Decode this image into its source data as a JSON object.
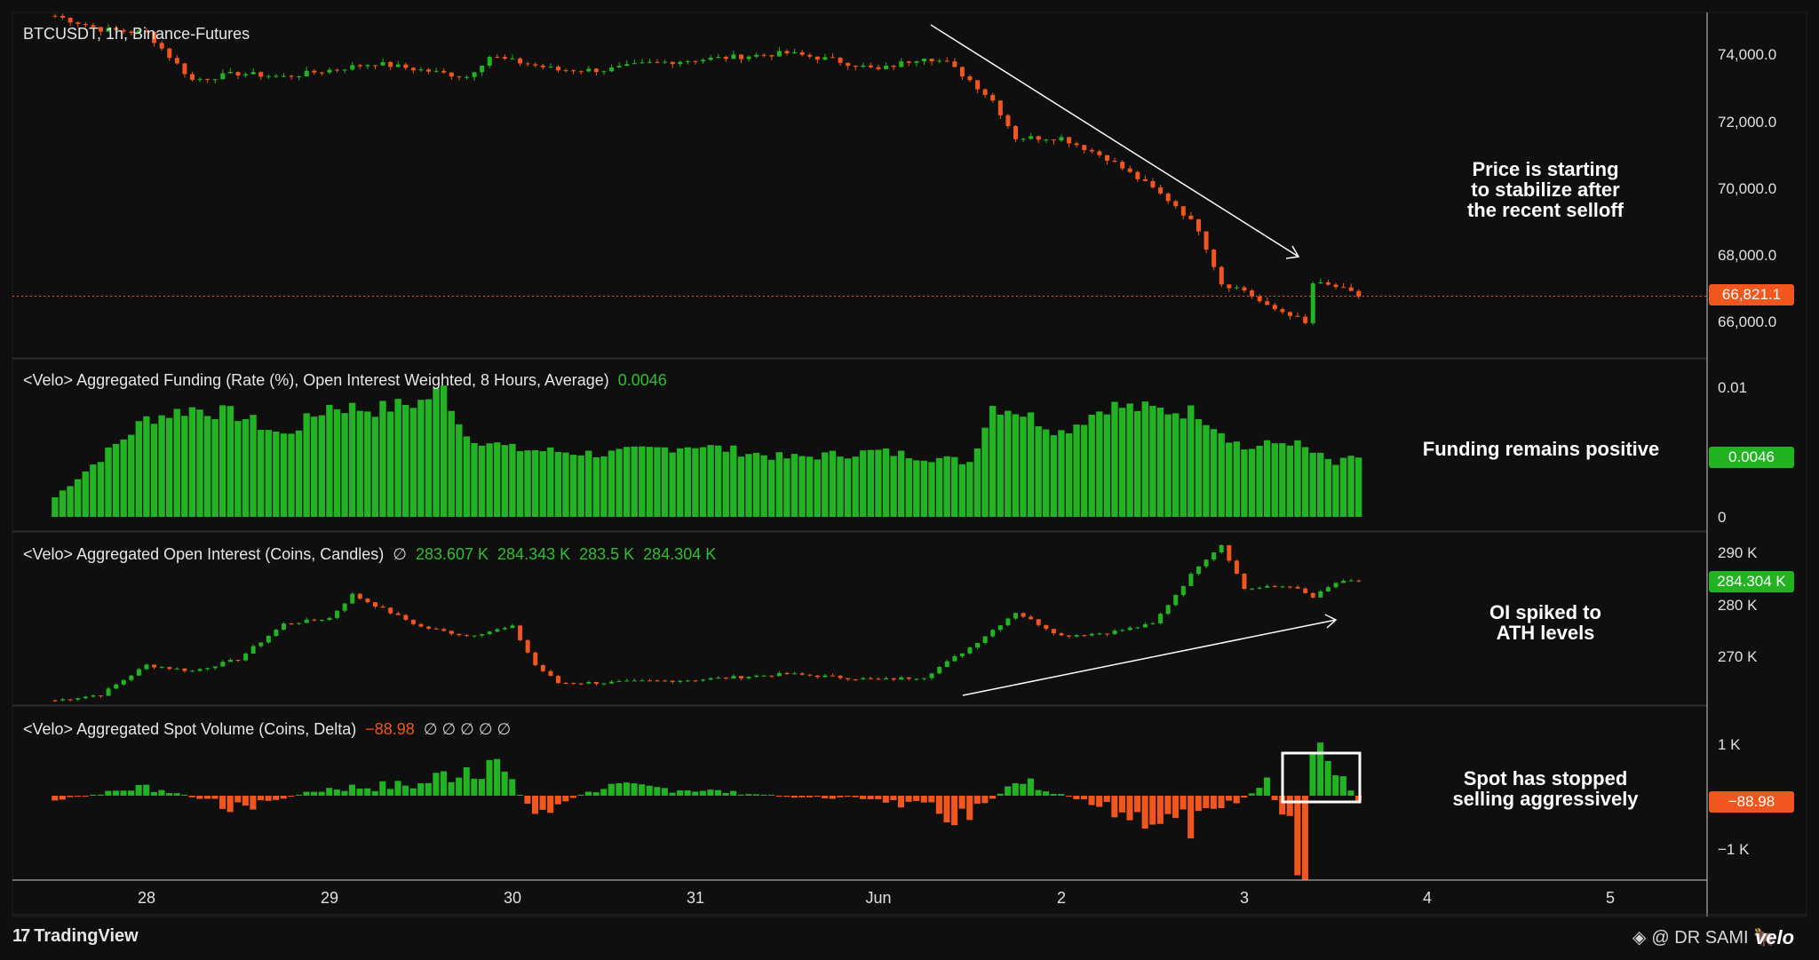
{
  "header": {
    "symbol_line": "BTCUSDT, 1h, Binance-Futures"
  },
  "legends": {
    "funding": {
      "text": "<Velo> Aggregated Funding (Rate (%), Open Interest Weighted, 8 Hours, Average)",
      "value": "0.0046"
    },
    "oi": {
      "text": "<Velo> Aggregated Open Interest (Coins, Candles)",
      "icon": "∅",
      "o": "283.607 K",
      "h": "284.343 K",
      "l": "283.5 K",
      "c": "284.304 K"
    },
    "spot": {
      "text": "<Velo> Aggregated Spot Volume (Coins, Delta)",
      "value": "−88.98",
      "icons": "∅  ∅  ∅  ∅  ∅"
    }
  },
  "notes": {
    "price": "Price is starting\nto stabilize after\nthe recent selloff",
    "funding": "Funding remains positive",
    "oi": "OI spiked to\nATH levels",
    "spot": "Spot has stopped\nselling aggressively"
  },
  "price_axis": [
    "74,000.0",
    "72,000.0",
    "70,000.0",
    "68,000.0",
    "66,000.0"
  ],
  "price_badge": "66,821.1",
  "funding_axis": [
    "0.01",
    "0"
  ],
  "funding_badge": "0.0046",
  "oi_axis": [
    "290 K",
    "280 K",
    "270 K"
  ],
  "oi_badge": "284.304 K",
  "spot_axis": [
    "1 K",
    "−1 K"
  ],
  "spot_badge": "−88.98",
  "x_axis": [
    "28",
    "29",
    "30",
    "31",
    "Jun",
    "2",
    "3",
    "4",
    "5"
  ],
  "footer": {
    "brand": "TradingView",
    "watermark": "@ DR SAMI 🐂",
    "velo": "velo"
  },
  "colors": {
    "up": "#22b322",
    "down": "#f0561d",
    "bg": "#0f0f0f",
    "grid": "#262626"
  },
  "chart_data": [
    {
      "type": "candlestick",
      "title": "BTCUSDT, 1h, Binance-Futures",
      "ylim": [
        65000,
        75200
      ],
      "x_range": [
        "May 27 12:00",
        "Jun 3 15:00"
      ],
      "anchors": [
        [
          "May 27 12:00",
          75100
        ],
        [
          "May 27 18:00",
          74700
        ],
        [
          "May 28 00:00",
          74600
        ],
        [
          "May 28 06:00",
          73200
        ],
        [
          "May 28 12:00",
          73400
        ],
        [
          "May 28 18:00",
          73300
        ],
        [
          "May 29 00:00",
          73500
        ],
        [
          "May 29 06:00",
          73700
        ],
        [
          "May 29 12:00",
          73500
        ],
        [
          "May 29 18:00",
          73300
        ],
        [
          "May 29 21:00",
          73900
        ],
        [
          "May 30 06:00",
          73500
        ],
        [
          "May 30 12:00",
          73500
        ],
        [
          "May 30 18:00",
          73700
        ],
        [
          "May 31 00:00",
          73800
        ],
        [
          "May 31 06:00",
          73900
        ],
        [
          "May 31 12:00",
          74000
        ],
        [
          "May 31 18:00",
          73800
        ],
        [
          "Jun 1 00:00",
          73500
        ],
        [
          "Jun 1 06:00",
          73900
        ],
        [
          "Jun 1 09:00",
          73700
        ],
        [
          "Jun 1 12:00",
          73200
        ],
        [
          "Jun 1 15:00",
          72600
        ],
        [
          "Jun 1 18:00",
          71500
        ],
        [
          "Jun 2 00:00",
          71500
        ],
        [
          "Jun 2 03:00",
          71200
        ],
        [
          "Jun 2 06:00",
          70900
        ],
        [
          "Jun 2 12:00",
          70000
        ],
        [
          "Jun 2 15:00",
          69500
        ],
        [
          "Jun 2 18:00",
          68800
        ],
        [
          "Jun 2 21:00",
          67200
        ],
        [
          "Jun 3 00:00",
          67000
        ],
        [
          "Jun 3 03:00",
          66500
        ],
        [
          "Jun 3 06:00",
          66300
        ],
        [
          "Jun 3 08:00",
          66000
        ],
        [
          "Jun 3 09:00",
          67200
        ],
        [
          "Jun 3 12:00",
          67100
        ],
        [
          "Jun 3 15:00",
          66821.1
        ]
      ],
      "last": 66821.1
    },
    {
      "type": "bar",
      "title": "<Velo> Aggregated Funding (Rate (%), Open Interest Weighted, 8 Hours, Average)",
      "ylim": [
        0,
        0.011
      ],
      "anchors": [
        [
          "May 27 12:00",
          0.0015
        ],
        [
          "May 27 18:00",
          0.0045
        ],
        [
          "May 28 00:00",
          0.0075
        ],
        [
          "May 28 06:00",
          0.0083
        ],
        [
          "May 28 12:00",
          0.0078
        ],
        [
          "May 28 18:00",
          0.0062
        ],
        [
          "May 29 00:00",
          0.0085
        ],
        [
          "May 29 06:00",
          0.0082
        ],
        [
          "May 29 12:00",
          0.0088
        ],
        [
          "May 29 15:00",
          0.0098
        ],
        [
          "May 29 18:00",
          0.0062
        ],
        [
          "May 30 00:00",
          0.0052
        ],
        [
          "May 30 12:00",
          0.0048
        ],
        [
          "May 31 00:00",
          0.0055
        ],
        [
          "May 31 12:00",
          0.0045
        ],
        [
          "Jun 1 00:00",
          0.005
        ],
        [
          "Jun 1 12:00",
          0.0042
        ],
        [
          "Jun 1 15:00",
          0.0085
        ],
        [
          "Jun 1 18:00",
          0.0082
        ],
        [
          "Jun 2 00:00",
          0.0065
        ],
        [
          "Jun 2 06:00",
          0.0085
        ],
        [
          "Jun 2 12:00",
          0.0082
        ],
        [
          "Jun 2 18:00",
          0.008
        ],
        [
          "Jun 3 00:00",
          0.0052
        ],
        [
          "Jun 3 06:00",
          0.0058
        ],
        [
          "Jun 3 12:00",
          0.004
        ],
        [
          "Jun 3 15:00",
          0.0046
        ]
      ],
      "last": 0.0046
    },
    {
      "type": "candlestick",
      "title": "<Velo> Aggregated Open Interest (Coins, Candles)",
      "ylim": [
        263500,
        292500
      ],
      "anchors": [
        [
          "May 27 12:00",
          264000
        ],
        [
          "May 27 18:00",
          265000
        ],
        [
          "May 28 00:00",
          270000
        ],
        [
          "May 28 06:00",
          269000
        ],
        [
          "May 28 12:00",
          271000
        ],
        [
          "May 28 18:00",
          277000
        ],
        [
          "May 29 00:00",
          278000
        ],
        [
          "May 29 03:00",
          282000
        ],
        [
          "May 29 12:00",
          276500
        ],
        [
          "May 29 18:00",
          275000
        ],
        [
          "May 30 00:00",
          276500
        ],
        [
          "May 30 03:00",
          270000
        ],
        [
          "May 30 06:00",
          267000
        ],
        [
          "May 30 12:00",
          267000
        ],
        [
          "May 31 00:00",
          267500
        ],
        [
          "May 31 12:00",
          268500
        ],
        [
          "Jun 1 00:00",
          267500
        ],
        [
          "Jun 1 06:00",
          268000
        ],
        [
          "Jun 1 12:00",
          273000
        ],
        [
          "Jun 1 18:00",
          279000
        ],
        [
          "Jun 2 00:00",
          275000
        ],
        [
          "Jun 2 06:00",
          275500
        ],
        [
          "Jun 2 12:00",
          277000
        ],
        [
          "Jun 2 18:00",
          287000
        ],
        [
          "Jun 2 21:00",
          290500
        ],
        [
          "Jun 3 00:00",
          283000
        ],
        [
          "Jun 3 06:00",
          283500
        ],
        [
          "Jun 3 09:00",
          281500
        ],
        [
          "Jun 3 12:00",
          284000
        ],
        [
          "Jun 3 15:00",
          284304
        ]
      ],
      "last": 284304
    },
    {
      "type": "bar",
      "title": "<Velo> Aggregated Spot Volume (Coins, Delta)",
      "ylim": [
        -1350,
        1450
      ],
      "anchors": [
        [
          "May 27 12:00",
          -80
        ],
        [
          "May 28 00:00",
          150
        ],
        [
          "May 28 12:00",
          -200
        ],
        [
          "May 29 00:00",
          120
        ],
        [
          "May 29 12:00",
          180
        ],
        [
          "May 29 21:00",
          650
        ],
        [
          "May 30 03:00",
          -300
        ],
        [
          "May 30 12:00",
          150
        ],
        [
          "May 31 00:00",
          100
        ],
        [
          "May 31 12:00",
          -20
        ],
        [
          "Jun 1 00:00",
          -50
        ],
        [
          "Jun 1 12:00",
          -400
        ],
        [
          "Jun 1 18:00",
          300
        ],
        [
          "Jun 2 06:00",
          -250
        ],
        [
          "Jun 2 18:00",
          -500
        ],
        [
          "Jun 3 03:00",
          200
        ],
        [
          "Jun 3 08:00",
          -1150
        ],
        [
          "Jun 3 09:00",
          700
        ],
        [
          "Jun 3 12:00",
          350
        ],
        [
          "Jun 3 15:00",
          -88.98
        ]
      ],
      "last": -88.98
    }
  ]
}
